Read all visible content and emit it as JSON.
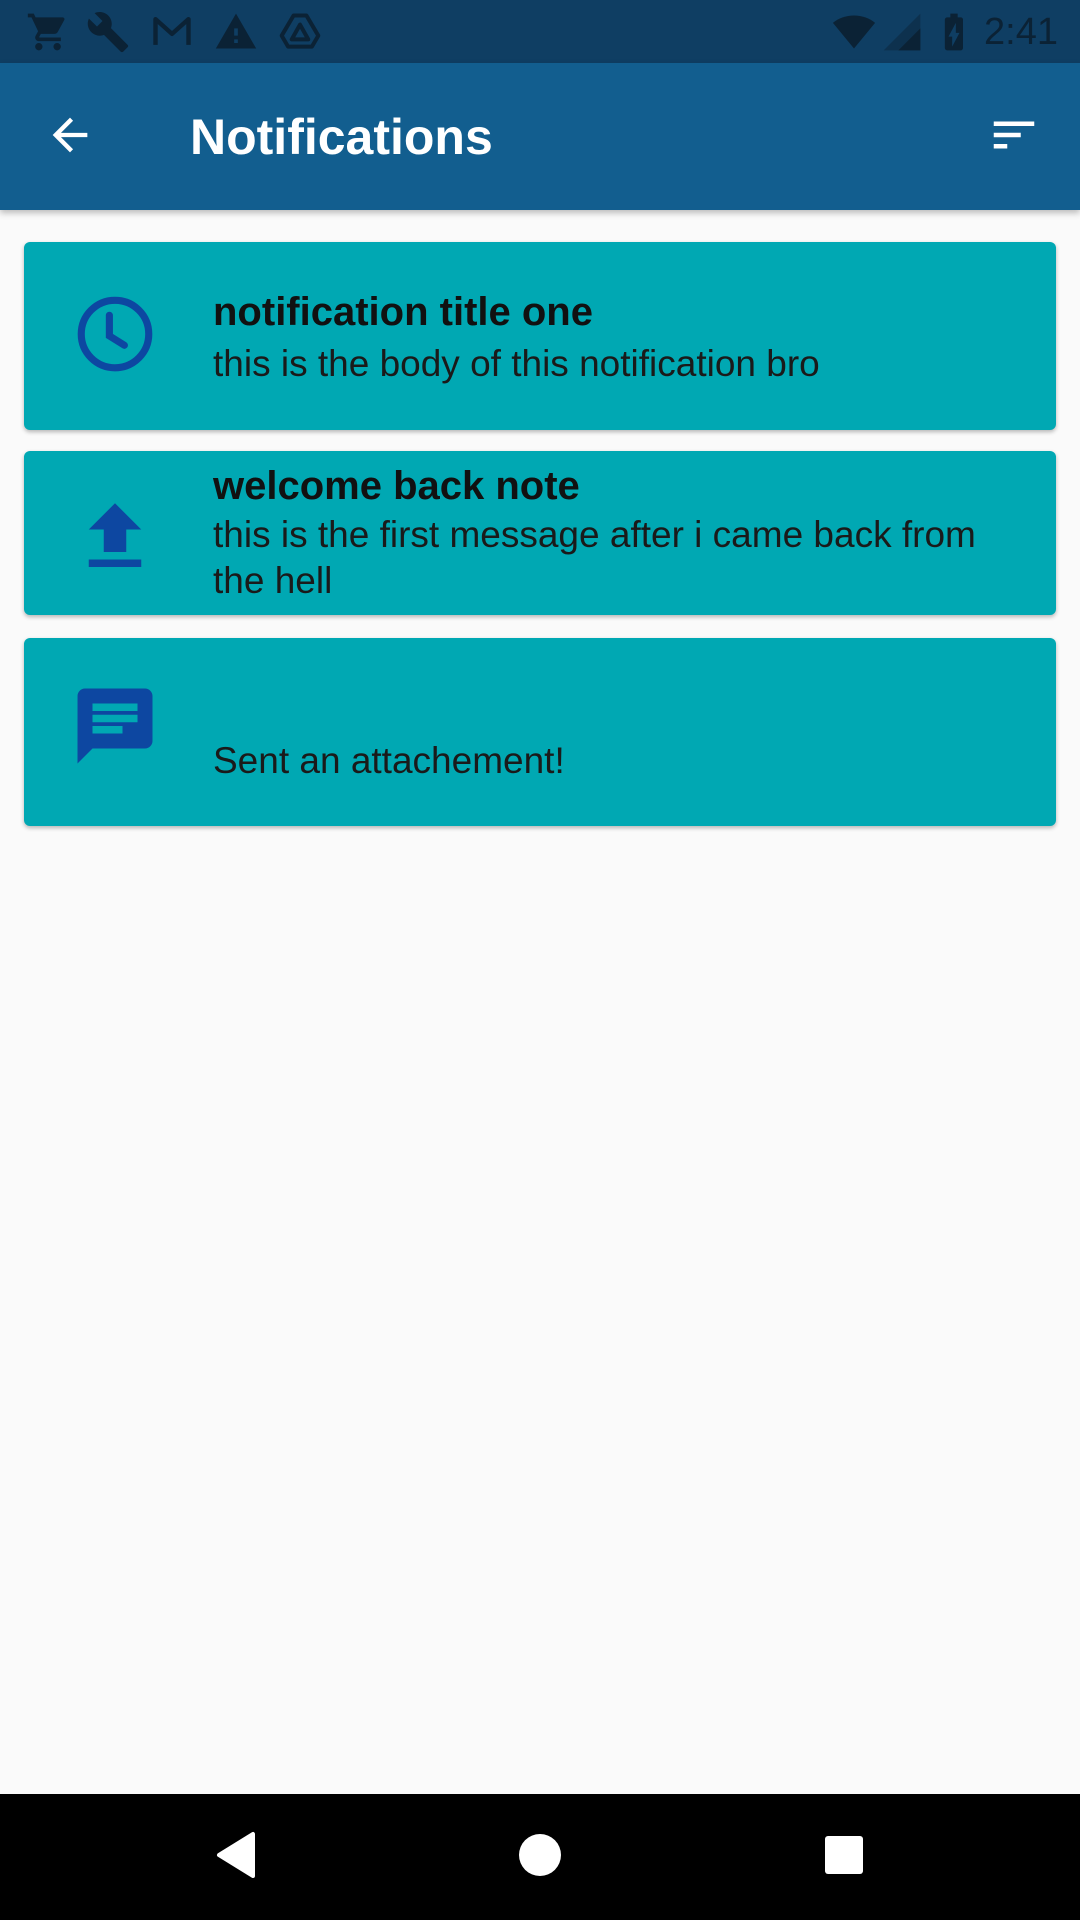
{
  "status_bar": {
    "time": "2:41",
    "left_icons": [
      "shopping-cart-icon",
      "wrench-icon",
      "gmail-icon",
      "warning-icon",
      "drive-icon"
    ],
    "right_icons": [
      "wifi-icon",
      "cellular-signal-icon",
      "battery-charging-icon"
    ]
  },
  "app_bar": {
    "title": "Notifications",
    "back_icon": "arrow-back-icon",
    "sort_icon": "sort-icon",
    "background": "#125E8F"
  },
  "notifications": [
    {
      "icon": "clock-icon",
      "title": "notification title one",
      "body": "this is the body of this notification bro"
    },
    {
      "icon": "upload-icon",
      "title": "welcome back note",
      "body": "this is the first message after i came back from the hell"
    },
    {
      "icon": "message-icon",
      "title": "",
      "body": "Sent an attachement!"
    }
  ],
  "colors": {
    "card": "#00A8B3",
    "icon": "#0D47A1",
    "status_bar": "#0F3E63",
    "background": "#FAFAFA"
  },
  "nav_bar": {
    "icons": [
      "nav-back-icon",
      "nav-home-icon",
      "nav-recents-icon"
    ]
  }
}
